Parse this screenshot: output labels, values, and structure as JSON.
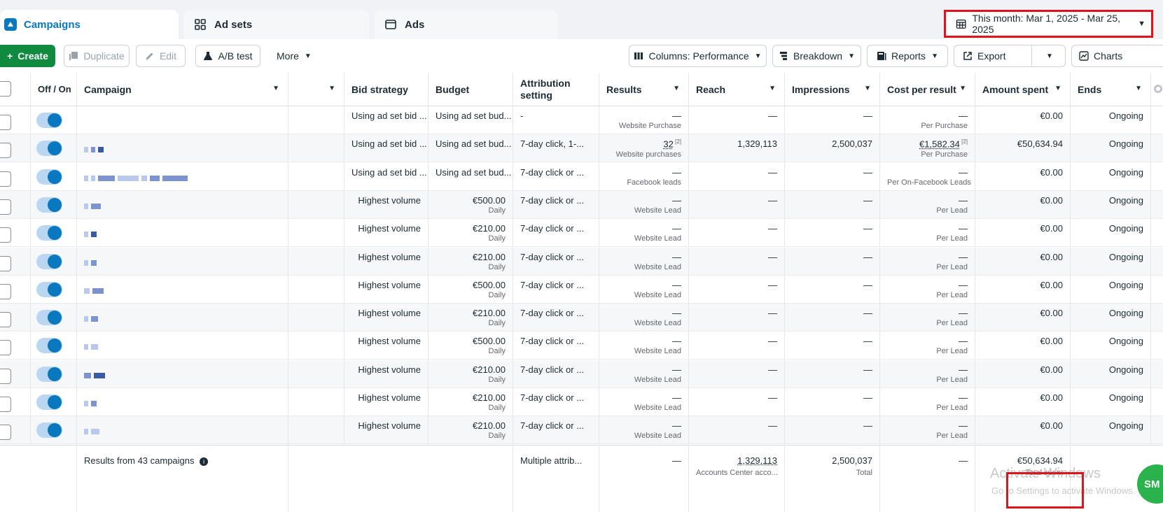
{
  "tabs": [
    {
      "label": "Campaigns",
      "active": true,
      "icon": "campaigns-icon"
    },
    {
      "label": "Ad sets",
      "active": false,
      "icon": "adsets-grid-icon"
    },
    {
      "label": "Ads",
      "active": false,
      "icon": "ads-window-icon"
    }
  ],
  "date_range": "This month: Mar 1, 2025 - Mar 25, 2025",
  "toolbar": {
    "create": "Create",
    "duplicate": "Duplicate",
    "edit": "Edit",
    "ab_test": "A/B test",
    "more": "More",
    "columns": "Columns: Performance",
    "breakdown": "Breakdown",
    "reports": "Reports",
    "export": "Export",
    "charts": "Charts"
  },
  "columns": {
    "off_on": "Off / On",
    "campaign": "Campaign",
    "bid_strategy": "Bid strategy",
    "budget": "Budget",
    "attribution": "Attribution setting",
    "results": "Results",
    "reach": "Reach",
    "impressions": "Impressions",
    "cost_per_result": "Cost per result",
    "amount_spent": "Amount spent",
    "ends": "Ends"
  },
  "rows": [
    {
      "bid": "Using ad set bid ...",
      "budget": "Using ad set bud...",
      "budget_sub": "",
      "attribution": "-",
      "results": "—",
      "results_sub": "Website Purchase",
      "reach": "—",
      "impressions": "—",
      "cpr": "—",
      "cpr_sub": "Per Purchase",
      "spent": "€0.00",
      "ends": "Ongoing"
    },
    {
      "bid": "Using ad set bid ...",
      "budget": "Using ad set bud...",
      "budget_sub": "",
      "attribution": "7-day click, 1-...",
      "results": "32",
      "results_sup": "[2]",
      "results_sub": "Website purchases",
      "reach": "1,329,113",
      "impressions": "2,500,037",
      "cpr": "€1,582.34",
      "cpr_sup": "[2]",
      "cpr_sub": "Per Purchase",
      "spent": "€50,634.94",
      "ends": "Ongoing"
    },
    {
      "bid": "Using ad set bid ...",
      "budget": "Using ad set bud...",
      "budget_sub": "",
      "attribution": "7-day click or ...",
      "results": "—",
      "results_sub": "Facebook leads",
      "reach": "—",
      "impressions": "—",
      "cpr": "—",
      "cpr_sub": "Per On-Facebook Leads",
      "spent": "€0.00",
      "ends": "Ongoing"
    },
    {
      "bid": "Highest volume",
      "budget": "€500.00",
      "budget_sub": "Daily",
      "attribution": "7-day click or ...",
      "results": "—",
      "results_sub": "Website Lead",
      "reach": "—",
      "impressions": "—",
      "cpr": "—",
      "cpr_sub": "Per Lead",
      "spent": "€0.00",
      "ends": "Ongoing"
    },
    {
      "bid": "Highest volume",
      "budget": "€210.00",
      "budget_sub": "Daily",
      "attribution": "7-day click or ...",
      "results": "—",
      "results_sub": "Website Lead",
      "reach": "—",
      "impressions": "—",
      "cpr": "—",
      "cpr_sub": "Per Lead",
      "spent": "€0.00",
      "ends": "Ongoing"
    },
    {
      "bid": "Highest volume",
      "budget": "€210.00",
      "budget_sub": "Daily",
      "attribution": "7-day click or ...",
      "results": "—",
      "results_sub": "Website Lead",
      "reach": "—",
      "impressions": "—",
      "cpr": "—",
      "cpr_sub": "Per Lead",
      "spent": "€0.00",
      "ends": "Ongoing"
    },
    {
      "bid": "Highest volume",
      "budget": "€500.00",
      "budget_sub": "Daily",
      "attribution": "7-day click or ...",
      "results": "—",
      "results_sub": "Website Lead",
      "reach": "—",
      "impressions": "—",
      "cpr": "—",
      "cpr_sub": "Per Lead",
      "spent": "€0.00",
      "ends": "Ongoing"
    },
    {
      "bid": "Highest volume",
      "budget": "€210.00",
      "budget_sub": "Daily",
      "attribution": "7-day click or ...",
      "results": "—",
      "results_sub": "Website Lead",
      "reach": "—",
      "impressions": "—",
      "cpr": "—",
      "cpr_sub": "Per Lead",
      "spent": "€0.00",
      "ends": "Ongoing"
    },
    {
      "bid": "Highest volume",
      "budget": "€500.00",
      "budget_sub": "Daily",
      "attribution": "7-day click or ...",
      "results": "—",
      "results_sub": "Website Lead",
      "reach": "—",
      "impressions": "—",
      "cpr": "—",
      "cpr_sub": "Per Lead",
      "spent": "€0.00",
      "ends": "Ongoing"
    },
    {
      "bid": "Highest volume",
      "budget": "€210.00",
      "budget_sub": "Daily",
      "attribution": "7-day click or ...",
      "results": "—",
      "results_sub": "Website Lead",
      "reach": "—",
      "impressions": "—",
      "cpr": "—",
      "cpr_sub": "Per Lead",
      "spent": "€0.00",
      "ends": "Ongoing"
    },
    {
      "bid": "Highest volume",
      "budget": "€210.00",
      "budget_sub": "Daily",
      "attribution": "7-day click or ...",
      "results": "—",
      "results_sub": "Website Lead",
      "reach": "—",
      "impressions": "—",
      "cpr": "—",
      "cpr_sub": "Per Lead",
      "spent": "€0.00",
      "ends": "Ongoing"
    },
    {
      "bid": "Highest volume",
      "budget": "€210.00",
      "budget_sub": "Daily",
      "attribution": "7-day click or ...",
      "results": "—",
      "results_sub": "Website Lead",
      "reach": "—",
      "impressions": "—",
      "cpr": "—",
      "cpr_sub": "Per Lead",
      "spent": "€0.00",
      "ends": "Ongoing"
    }
  ],
  "footer": {
    "summary": "Results from 43 campaigns",
    "attribution": "Multiple attrib...",
    "results": "—",
    "reach": "1,329,113",
    "reach_sub": "Accounts Center acco...",
    "impressions": "2,500,037",
    "impressions_sub": "Total",
    "cpr": "—",
    "spent": "€50,634.94",
    "spent_sub": "Total spent"
  },
  "watermark": {
    "line1": "Activate Windows",
    "line2": "Go to Settings to activate Windows."
  },
  "badge": "SM",
  "colors": {
    "accent": "#0a78be",
    "create_green": "#108a3e",
    "highlight_red": "#e0121b"
  }
}
